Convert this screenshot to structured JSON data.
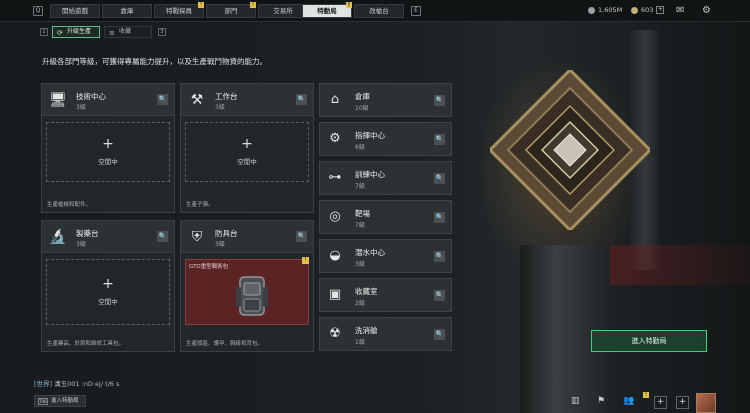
{
  "topbar": {
    "left_key": "Q",
    "right_key": "E",
    "tabs": [
      {
        "label": "開始遊戲",
        "alert": ""
      },
      {
        "label": "倉庫",
        "alert": ""
      },
      {
        "label": "特戰探員",
        "alert": "!"
      },
      {
        "label": "部門",
        "alert": "!"
      },
      {
        "label": "交易所",
        "alert": ""
      },
      {
        "label": "特勤局",
        "alert": "!"
      },
      {
        "label": "改槍台",
        "alert": ""
      }
    ],
    "currency_1": "1,605M",
    "currency_2": "603",
    "plus": "+"
  },
  "subtabs": {
    "key_left": "1",
    "key_right": "3",
    "items": [
      {
        "label": "升級生產",
        "icon": "upgrade-icon"
      },
      {
        "label": "收藏",
        "icon": "collection-icon"
      }
    ]
  },
  "description": "升級各部門等級，可獲得專屬能力提升，以及生產戰鬥物資的能力。",
  "cards": [
    {
      "name": "技術中心",
      "level": "3級",
      "slot": "空閒中",
      "plus": "+",
      "desc": "生產槍械和配件。",
      "icon": "monitor-icon"
    },
    {
      "name": "工作台",
      "level": "3級",
      "slot": "空閒中",
      "plus": "+",
      "desc": "生產子彈。",
      "icon": "tools-icon"
    },
    {
      "name": "製藥台",
      "level": "3級",
      "slot": "空閒中",
      "plus": "+",
      "desc": "生產藥品、針劑和維修工具包。",
      "icon": "microscope-icon"
    },
    {
      "name": "防具台",
      "level": "3級",
      "item": "GTO重型戰術包",
      "item_alert": "!",
      "desc": "生產頭盔、護甲、胸掛和背包。",
      "icon": "armor-icon"
    }
  ],
  "list": [
    {
      "name": "倉庫",
      "level": "10級",
      "icon": "warehouse-icon"
    },
    {
      "name": "指揮中心",
      "level": "6級",
      "icon": "command-icon"
    },
    {
      "name": "訓練中心",
      "level": "7級",
      "icon": "dumbbell-icon"
    },
    {
      "name": "靶場",
      "level": "7級",
      "icon": "target-icon"
    },
    {
      "name": "潛水中心",
      "level": "3級",
      "icon": "diving-icon"
    },
    {
      "name": "收藏室",
      "level": "2級",
      "icon": "collection-room-icon"
    },
    {
      "name": "洗消艙",
      "level": "1級",
      "icon": "hazard-icon"
    }
  ],
  "search_glyph": "🔍",
  "enter_button": "進入特勤局",
  "chat": {
    "channel": "[世界]",
    "message": "溝玉001 :nD ej/ t/6 s",
    "button_key": "TAB",
    "button_label": "進入特勤局"
  },
  "bottom": {
    "badge": "!",
    "plus": "+"
  },
  "colors": {
    "accent_green": "#3fcf7a",
    "alert_yellow": "#e0c14a",
    "item_red": "#5a2424"
  }
}
